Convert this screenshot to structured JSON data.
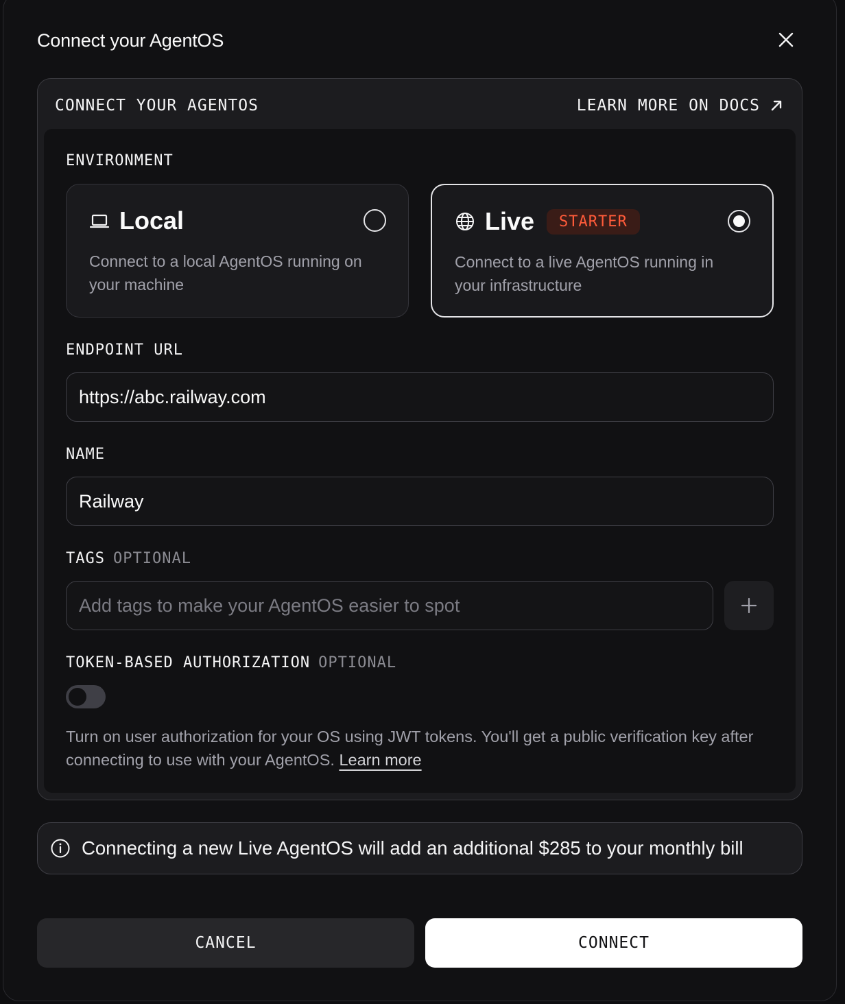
{
  "modal": {
    "title": "Connect your AgentOS",
    "close_icon": "close-icon"
  },
  "panel": {
    "header_title": "CONNECT YOUR AGENTOS",
    "docs_link": "LEARN MORE ON DOCS",
    "docs_icon": "arrow-up-right-icon"
  },
  "environment": {
    "label": "ENVIRONMENT",
    "options": [
      {
        "title": "Local",
        "icon": "laptop-icon",
        "description": "Connect to a local AgentOS running on your machine",
        "selected": false
      },
      {
        "title": "Live",
        "icon": "globe-icon",
        "badge": "STARTER",
        "description": "Connect to a live AgentOS running in your infrastructure",
        "selected": true
      }
    ]
  },
  "endpoint": {
    "label": "ENDPOINT URL",
    "value": "https://abc.railway.com"
  },
  "name": {
    "label": "NAME",
    "value": "Railway"
  },
  "tags": {
    "label": "TAGS",
    "optional": "OPTIONAL",
    "placeholder": "Add tags to make your AgentOS easier to spot",
    "add_icon": "plus-icon"
  },
  "auth": {
    "label": "TOKEN-BASED AUTHORIZATION",
    "optional": "OPTIONAL",
    "enabled": false,
    "description": "Turn on user authorization for your OS using JWT tokens. You'll get a public verification key after connecting to use with your AgentOS.",
    "learn_more": "Learn more"
  },
  "notice": {
    "icon": "info-icon",
    "text": "Connecting a new Live AgentOS will add an additional $285 to your monthly bill"
  },
  "actions": {
    "cancel": "CANCEL",
    "connect": "CONNECT"
  },
  "colors": {
    "background": "#111113",
    "panel": "#1c1c1f",
    "badge_text": "#ff5b3a",
    "badge_bg": "#3a1c17",
    "primary_button": "#ffffff"
  }
}
